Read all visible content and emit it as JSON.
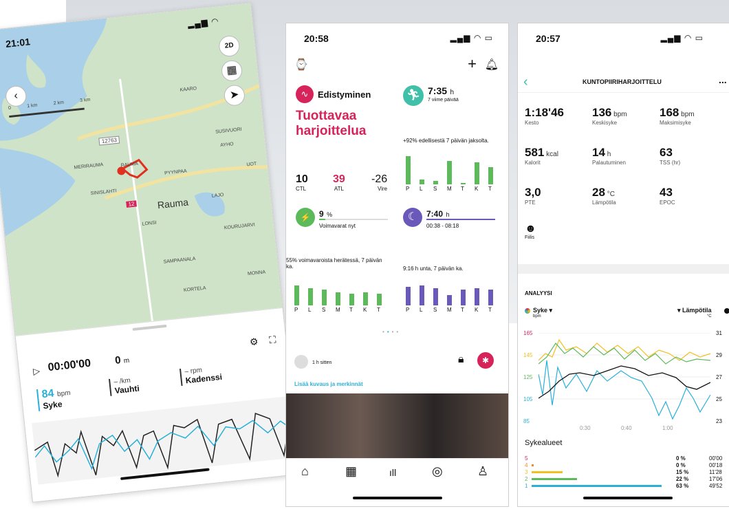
{
  "phone1": {
    "time": "21:01",
    "map_places": [
      "KAARO",
      "MERIRAUMA",
      "RAUMA",
      "SUSIVUORI",
      "AYHO",
      "PYYNPAA",
      "UOT",
      "Rauma",
      "LAJO",
      "LONSI",
      "KOURUJARVI",
      "SAMPAANALA",
      "MONNA",
      "KORTELA",
      "SINISLAHTI"
    ],
    "road": "12763",
    "road2": "12",
    "scale": [
      "0",
      "1 km",
      "2 km",
      "3 km"
    ],
    "btn_2d": "2D",
    "duration": "00:00'00",
    "distance_value": "0",
    "distance_unit": "m",
    "hr_value": "84",
    "hr_unit": "bpm",
    "hr_label": "Syke",
    "pace_value": "–",
    "pace_unit": "/km",
    "pace_label": "Vauhti",
    "cad_value": "–",
    "cad_unit": "rpm",
    "cad_label": "Kadenssi"
  },
  "phone2": {
    "time": "20:58",
    "progress_title": "Edistyminen",
    "progress_status": "Tuottavaa harjoittelua",
    "ctl_value": "10",
    "ctl_label": "CTL",
    "atl_value": "39",
    "atl_label": "ATL",
    "vire_value": "-26",
    "vire_label": "Vire",
    "time_value": "7:35",
    "time_unit": "h",
    "time_sub": "7 viime päivää",
    "time_change": "+92% edellisestä 7 päivän jaksolta.",
    "days": [
      "P",
      "L",
      "S",
      "M",
      "T",
      "K",
      "T"
    ],
    "res_value": "9",
    "res_unit": "%",
    "res_label": "Voimavarat nyt",
    "sleep_value": "7:40",
    "sleep_unit": "h",
    "sleep_range": "00:38 - 08:18",
    "res_note": "55% voimavaroista herätessä, 7 päivän ka.",
    "sleep_note": "9:16 h unta, 7 päivän ka.",
    "feed_time": "1 h sitten",
    "feed_link": "Lisää kuvaus ja merkinnät",
    "colors": {
      "red": "#d6245a",
      "green": "#5dba5a",
      "purple": "#6a59b8",
      "teal": "#40c0a8",
      "link": "#2ab0d8"
    },
    "bars_training": [
      0.9,
      0.15,
      0.1,
      0.75,
      0.05,
      0.7,
      0.55
    ],
    "bars_res": [
      0.7,
      0.6,
      0.55,
      0.45,
      0.4,
      0.45,
      0.4
    ],
    "bars_sleep": [
      0.65,
      0.7,
      0.6,
      0.35,
      0.55,
      0.6,
      0.55
    ]
  },
  "phone3": {
    "time": "20:57",
    "title": "KUNTOPIIRIHARJOITTELU",
    "more": "...",
    "stats": [
      {
        "v": "1:18'46",
        "u": "",
        "l": "Kesto"
      },
      {
        "v": "136",
        "u": "bpm",
        "l": "Keskisyke"
      },
      {
        "v": "168",
        "u": "bpm",
        "l": "Maksimisyke"
      },
      {
        "v": "581",
        "u": "kcal",
        "l": "Kalorit"
      },
      {
        "v": "14",
        "u": "h",
        "l": "Palautuminen"
      },
      {
        "v": "63",
        "u": "",
        "l": "TSS (hr)"
      },
      {
        "v": "3,0",
        "u": "",
        "l": "PTE"
      },
      {
        "v": "28",
        "u": "°C",
        "l": "Lämpötila"
      },
      {
        "v": "43",
        "u": "",
        "l": "EPOC"
      }
    ],
    "feel_label": "Fiilis",
    "analysis": "ANALYYSI",
    "hr_sel": "Syke",
    "hr_unit": "bpm",
    "temp_sel": "Lämpötila",
    "temp_unit": "°C",
    "y_left": [
      "165",
      "145",
      "125",
      "105",
      "85"
    ],
    "y_right": [
      "31",
      "29",
      "27",
      "25",
      "23"
    ],
    "x_ticks": [
      "0:30",
      "0:40",
      "1:00"
    ],
    "zones_title": "Sykealueet",
    "zones": [
      {
        "n": "5",
        "p": "0 %",
        "t": "00'00",
        "c": "#d6245a",
        "f": 0
      },
      {
        "n": "4",
        "p": "0 %",
        "t": "00'18",
        "c": "#f08a30",
        "f": 0.01
      },
      {
        "n": "3",
        "p": "15 %",
        "t": "11'28",
        "c": "#f0c020",
        "f": 0.15
      },
      {
        "n": "2",
        "p": "22 %",
        "t": "17'06",
        "c": "#5dba5a",
        "f": 0.22
      },
      {
        "n": "1",
        "p": "63 %",
        "t": "49'52",
        "c": "#2ab0d8",
        "f": 0.63
      }
    ]
  }
}
